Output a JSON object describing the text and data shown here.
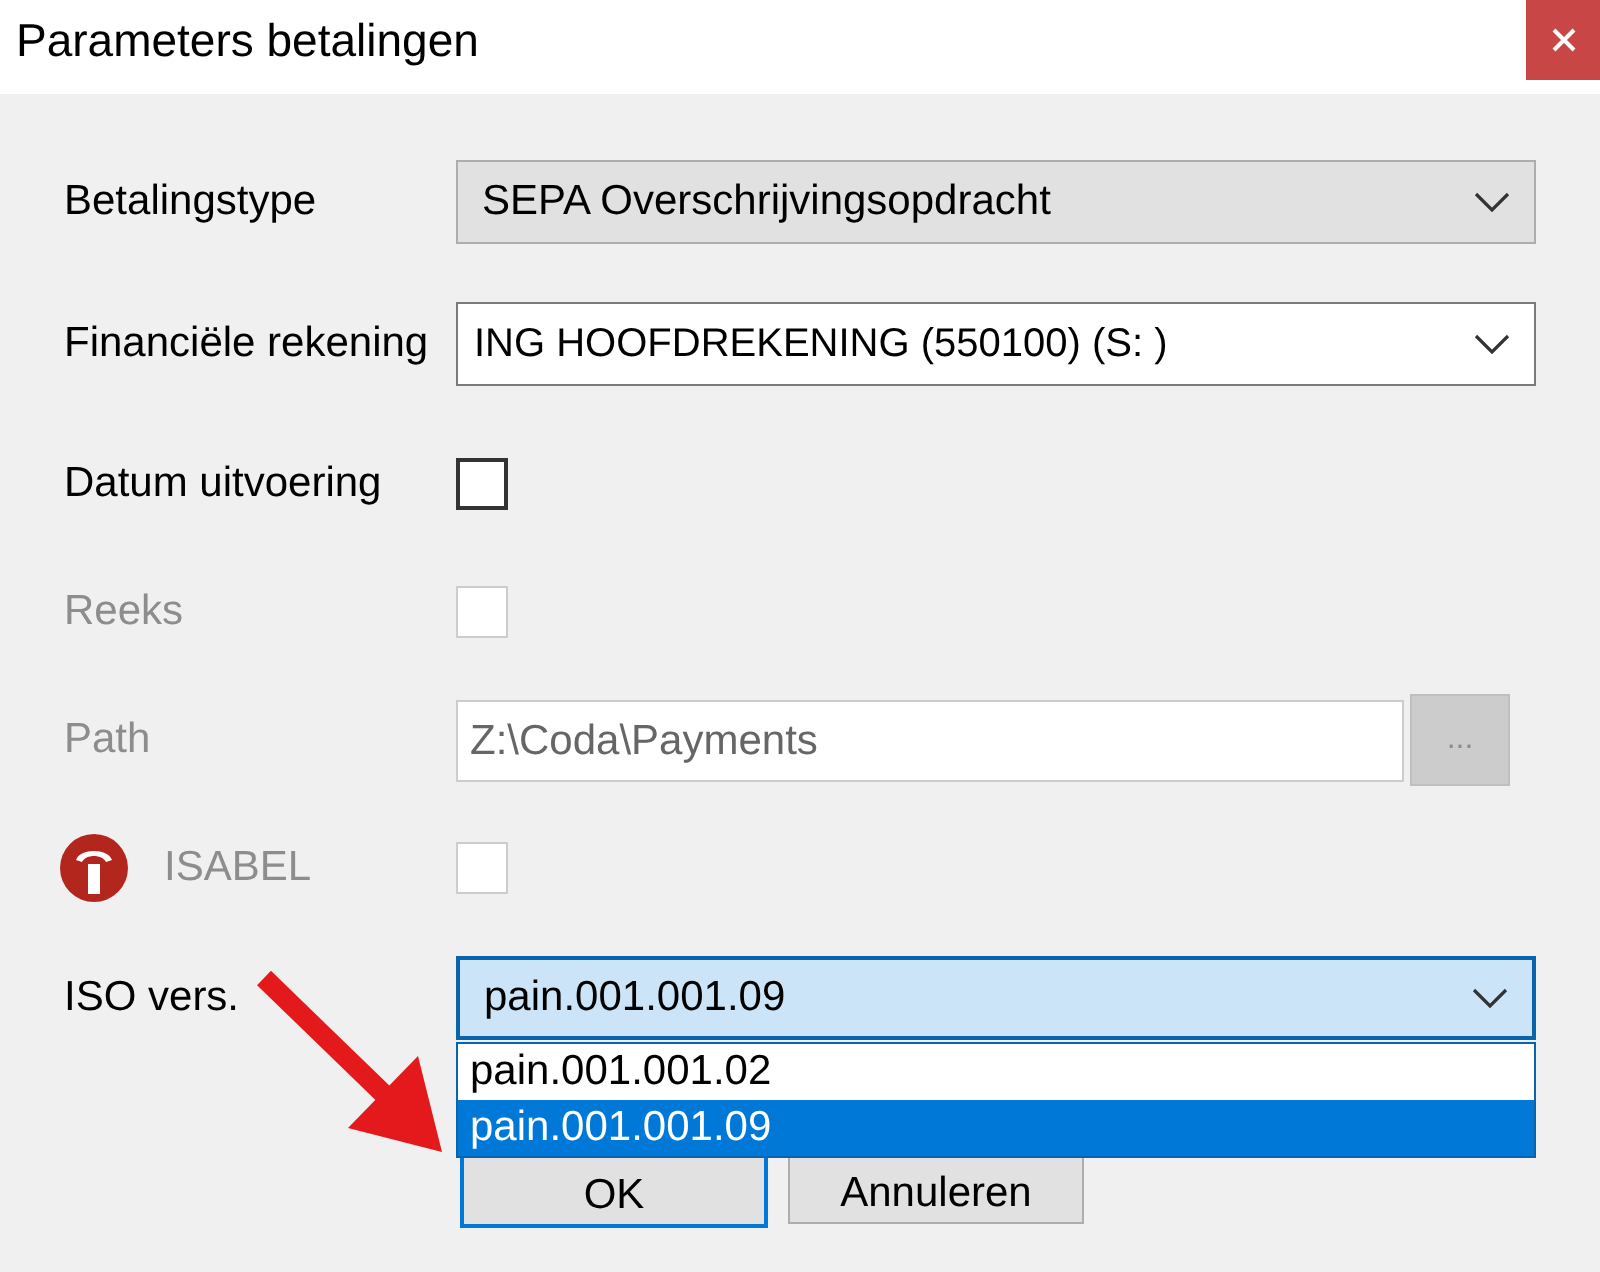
{
  "window": {
    "title": "Parameters betalingen"
  },
  "fields": [
    {
      "kind": "select",
      "label": "Betalingstype",
      "value": "SEPA Overschrijvingsopdracht",
      "disabled": false,
      "focused": false
    },
    {
      "kind": "combo",
      "label": "Financiële rekening",
      "value": "ING HOOFDREKENING (550100) (S: )",
      "disabled": false,
      "focused": false
    },
    {
      "kind": "checkbox",
      "label": "Datum uitvoering",
      "checked": false,
      "disabled": false,
      "logo": false
    },
    {
      "kind": "checkbox",
      "label": "Reeks",
      "checked": false,
      "disabled": true,
      "logo": false
    },
    {
      "kind": "path",
      "label": "Path",
      "value": "Z:\\Coda\\Payments",
      "browse_label": "...",
      "disabled": true
    },
    {
      "kind": "checkbox",
      "label": "ISABEL",
      "checked": false,
      "disabled": true,
      "logo": true
    },
    {
      "kind": "select",
      "label": "ISO vers.",
      "value": "pain.001.001.09",
      "disabled": false,
      "focused": true,
      "expanded": true,
      "options": [
        {
          "label": "pain.001.001.02",
          "selected": false
        },
        {
          "label": "pain.001.001.09",
          "selected": true
        }
      ]
    }
  ],
  "buttons": [
    {
      "label": "OK",
      "default": true
    },
    {
      "label": "Annuleren",
      "default": false
    }
  ]
}
